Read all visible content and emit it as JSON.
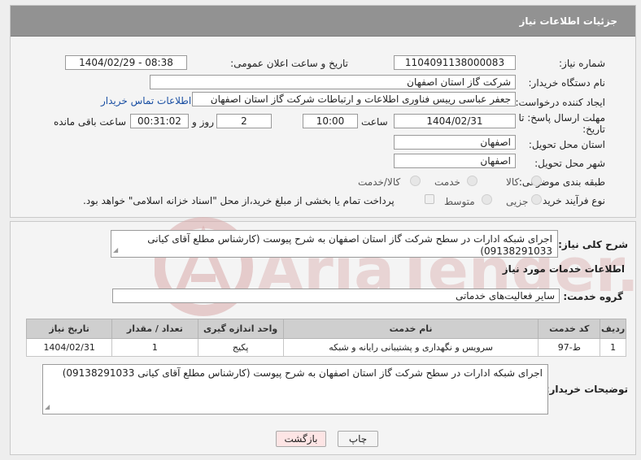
{
  "panel_title": "جزئیات اطلاعات نیاز",
  "fields": {
    "need_number_label": "شماره نیاز:",
    "need_number": "1104091138000083",
    "announce_label": "تاریخ و ساعت اعلان عمومی:",
    "announce_value": "1404/02/29 - 08:38",
    "buyer_label": "نام دستگاه خریدار:",
    "buyer_value": "شرکت گاز استان اصفهان",
    "creator_label": "ایجاد کننده درخواست:",
    "creator_value": "جعفر عباسی رییس فناوری اطلاعات و ارتباطات شرکت گاز استان اصفهان",
    "contact_link": "اطلاعات تماس خریدار",
    "deadline_label_1": "مهلت ارسال پاسخ: تا",
    "deadline_label_2": "تاریخ:",
    "deadline_date": "1404/02/31",
    "time_label": "ساعت",
    "deadline_time": "10:00",
    "days_value": "2",
    "days_label": "روز و",
    "remaining_value": "00:31:02",
    "remaining_label": "ساعت باقی مانده",
    "province_label": "استان محل تحویل:",
    "province_value": "اصفهان",
    "city_label": "شهر محل تحویل:",
    "city_value": "اصفهان",
    "category_label": "طبقه بندی موضوعی:",
    "category_options": [
      "کالا",
      "خدمت",
      "کالا/خدمت"
    ],
    "process_label": "نوع فرآیند خرید :",
    "process_options": [
      "جزیی",
      "متوسط"
    ],
    "payment_note": "پرداخت تمام یا بخشی از مبلغ خرید،از محل \"اسناد خزانه اسلامی\" خواهد بود."
  },
  "summary": {
    "label": "شرح کلی نیاز:",
    "text": "اجرای شبکه ادارات در سطح شرکت گاز استان اصفهان به شرح پیوست (کارشناس مطلع آقای کیانی 09138291033)"
  },
  "services": {
    "section_title": "اطلاعات خدمات مورد نیاز",
    "group_label": "گروه خدمت:",
    "group_value": "سایر فعالیت‌های خدماتی",
    "columns": [
      "ردیف",
      "کد خدمت",
      "نام خدمت",
      "واحد اندازه گیری",
      "تعداد / مقدار",
      "تاریخ نیاز"
    ],
    "rows": [
      [
        "1",
        "ط-97",
        "سرویس و نگهداری و پشتیبانی رایانه و شبکه",
        "پکیج",
        "1",
        "1404/02/31"
      ]
    ]
  },
  "buyer_notes": {
    "label": "توضیحات خریدار:",
    "text": "اجرای شبکه ادارات در سطح شرکت گاز استان اصفهان به شرح پیوست (کارشناس مطلع آقای کیانی 09138291033)"
  },
  "buttons": {
    "print": "چاپ",
    "back": "بازگشت"
  },
  "watermark": "AriaTender.net",
  "colors": {
    "header": "#929292",
    "link": "#1a4fa3",
    "back_button": "#fde5e5",
    "watermark": "#d9a9a9"
  }
}
